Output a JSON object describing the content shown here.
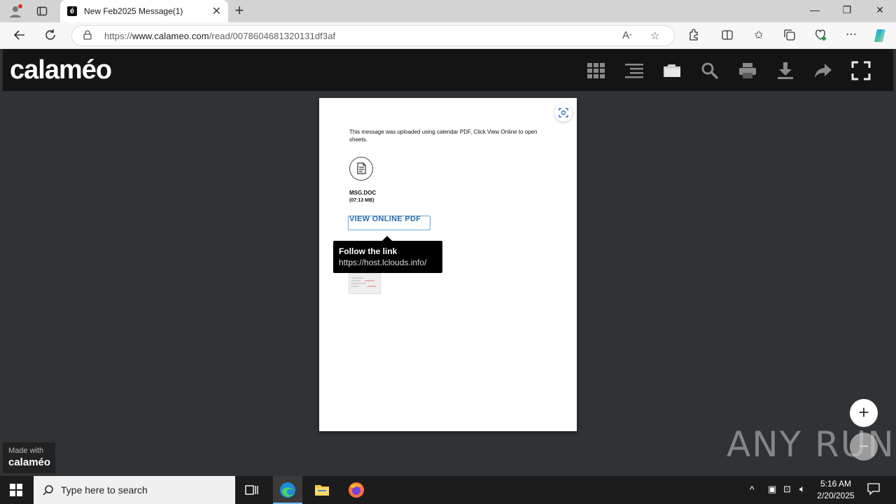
{
  "browser": {
    "tab_title": "New Feb2025 Message(1)",
    "tab_favicon": "é",
    "url_scheme": "https://",
    "url_host": "www.calameo.com",
    "url_path": "/read/0078604681320131df3af"
  },
  "calameo": {
    "logo": "calaméo",
    "tools": [
      "grid-view-icon",
      "list-icon",
      "folder-icon",
      "search-icon",
      "print-icon",
      "download-icon",
      "share-icon",
      "fullscreen-icon"
    ]
  },
  "document": {
    "message": "This message was uploaded using calendar PDF, Click View Online to open sheets.",
    "file_name": "MSG.DOC",
    "file_size": "(07:13 MB)",
    "link_label": "VIEW ONLINE PDF"
  },
  "tooltip": {
    "title": "Follow the link",
    "url": "https://host.lclouds.info/"
  },
  "badge": {
    "line1": "Made with",
    "line2": "calaméo"
  },
  "zoom": {
    "in": "+",
    "out": "−"
  },
  "watermark": "ANY RUN",
  "taskbar": {
    "search_placeholder": "Type here to search",
    "time": "5:16 AM",
    "date": "2/20/2025"
  },
  "colors": {
    "calameo_header": "#141414",
    "viewer_bg": "#2f3336",
    "link_blue": "#2a6db0"
  }
}
